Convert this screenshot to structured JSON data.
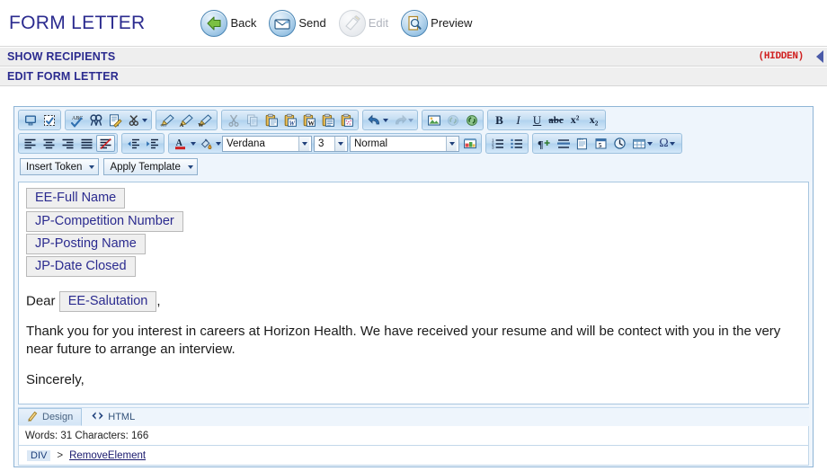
{
  "header": {
    "title": "FORM LETTER",
    "actions": [
      {
        "label": "Back",
        "icon": "back-arrow-icon",
        "enabled": true
      },
      {
        "label": "Send",
        "icon": "envelope-icon",
        "enabled": true
      },
      {
        "label": "Edit",
        "icon": "pencil-edit-icon",
        "enabled": false
      },
      {
        "label": "Preview",
        "icon": "magnifier-page-icon",
        "enabled": true
      }
    ]
  },
  "sections": {
    "recipients": {
      "title": "SHOW RECIPIENTS",
      "status": "(HIDDEN)",
      "collapse_icon": "left-triangle-icon"
    },
    "edit_letter": {
      "title": "EDIT FORM LETTER"
    }
  },
  "toolbar": {
    "row1": {
      "group1": [
        {
          "name": "toggle-view-icon",
          "title": "Toggle screen mode"
        },
        {
          "name": "select-all-icon",
          "title": "Select all"
        }
      ],
      "group2": [
        {
          "name": "spellcheck-icon",
          "title": "Spell check"
        },
        {
          "name": "find-replace-icon",
          "title": "Find and replace"
        },
        {
          "name": "edit-document-icon",
          "title": "Module manager"
        },
        {
          "name": "strip-formatting-icon",
          "title": "Strip formatting",
          "has_caret": true
        }
      ],
      "group3": [
        {
          "name": "format-painter-css-icon",
          "title": "Format stripper CSS"
        },
        {
          "name": "format-painter-font-icon",
          "title": "Format stripper font"
        },
        {
          "name": "format-painter-word-icon",
          "title": "Format stripper Word"
        }
      ],
      "group4": [
        {
          "name": "cut-icon",
          "title": "Cut",
          "disabled": true
        },
        {
          "name": "copy-icon",
          "title": "Copy",
          "disabled": true
        },
        {
          "name": "paste-icon",
          "title": "Paste"
        },
        {
          "name": "paste-from-word-icon",
          "title": "Paste from Word"
        },
        {
          "name": "paste-word-clean-icon",
          "title": "Paste from Word cleaned"
        },
        {
          "name": "paste-plain-text-icon",
          "title": "Paste plain text"
        },
        {
          "name": "paste-as-html-icon",
          "title": "Paste as HTML"
        }
      ],
      "group5": [
        {
          "name": "undo-icon",
          "title": "Undo",
          "has_caret": true
        },
        {
          "name": "redo-icon",
          "title": "Redo",
          "has_caret": true,
          "disabled": true
        }
      ],
      "group6": [
        {
          "name": "insert-image-icon",
          "title": "Image manager"
        },
        {
          "name": "insert-link-icon",
          "title": "Hyperlink manager",
          "disabled": true
        },
        {
          "name": "remove-link-icon",
          "title": "Remove link"
        }
      ],
      "group7": [
        {
          "name": "bold-icon",
          "label": "B",
          "title": "Bold"
        },
        {
          "name": "italic-icon",
          "label": "I",
          "title": "Italic"
        },
        {
          "name": "underline-icon",
          "label": "U",
          "title": "Underline"
        },
        {
          "name": "strikethrough-icon",
          "label": "abc",
          "title": "Strikethrough"
        },
        {
          "name": "superscript-icon",
          "label": "x²",
          "title": "Superscript"
        },
        {
          "name": "subscript-icon",
          "label": "x₂",
          "title": "Subscript"
        }
      ]
    },
    "row2": {
      "align_group": [
        {
          "name": "align-left-icon",
          "title": "Align left"
        },
        {
          "name": "align-center-icon",
          "title": "Align center"
        },
        {
          "name": "align-right-icon",
          "title": "Align right"
        },
        {
          "name": "align-justify-icon",
          "title": "Justify"
        },
        {
          "name": "align-none-icon",
          "title": "Remove alignment",
          "active": true
        }
      ],
      "indent_group": [
        {
          "name": "outdent-icon",
          "title": "Outdent"
        },
        {
          "name": "indent-icon",
          "title": "Indent"
        }
      ],
      "color_group": [
        {
          "name": "foreground-color-icon",
          "label": "A",
          "title": "Foreground color",
          "has_caret": true
        },
        {
          "name": "background-color-icon",
          "title": "Background color",
          "has_caret": true
        }
      ],
      "font_name": {
        "value": "Verdana",
        "name": "font-name-select"
      },
      "font_size": {
        "value": "3",
        "name": "font-size-select"
      },
      "paragraph_style": {
        "value": "Normal",
        "name": "paragraph-style-select"
      },
      "format_group": [
        {
          "name": "apply-css-class-icon",
          "title": "CSS class"
        }
      ],
      "list_group": [
        {
          "name": "numbered-list-icon",
          "title": "Numbered list"
        },
        {
          "name": "bulleted-list-icon",
          "title": "Bulleted list"
        }
      ],
      "misc_group": [
        {
          "name": "format-block-icon",
          "title": "New paragraph"
        },
        {
          "name": "horizontal-rule-icon",
          "title": "Horizontal rule"
        },
        {
          "name": "insert-snippet-icon",
          "title": "Insert snippet"
        },
        {
          "name": "insert-date-icon",
          "title": "Insert date"
        },
        {
          "name": "insert-time-icon",
          "title": "Insert time"
        },
        {
          "name": "insert-table-icon",
          "title": "Insert table",
          "has_caret": true
        },
        {
          "name": "insert-symbol-icon",
          "label": "Ω",
          "title": "Insert symbol",
          "has_caret": true
        }
      ]
    },
    "row3": [
      {
        "name": "insert-token-dropdown",
        "label": "Insert Token"
      },
      {
        "name": "apply-template-dropdown",
        "label": "Apply Template"
      }
    ]
  },
  "document": {
    "tokens_top": [
      "EE-Full Name",
      "JP-Competition Number",
      "JP-Posting Name",
      "JP-Date Closed"
    ],
    "salutation_prefix": "Dear",
    "salutation_token": "EE-Salutation",
    "salutation_suffix": ",",
    "body_paragraph": "Thank you for you interest in careers at Horizon Health. We have received your resume and will be contect with you in the very near future to arrange an interview.",
    "closing": "Sincerely,"
  },
  "footer": {
    "tabs": [
      {
        "label": "Design",
        "icon": "pencil-icon",
        "selected": true
      },
      {
        "label": "HTML",
        "icon": "code-brackets-icon",
        "selected": false
      }
    ],
    "status": "Words: 31 Characters: 166",
    "tag_path": {
      "element": "DIV",
      "separator": ">",
      "action": "RemoveElement"
    }
  },
  "colors": {
    "title_blue": "#2b2b8f",
    "hidden_red": "#d02020",
    "toolbar_blue": "#c3ddf2",
    "section_grey": "#eeeeee",
    "editor_border": "#8fb5d6"
  }
}
